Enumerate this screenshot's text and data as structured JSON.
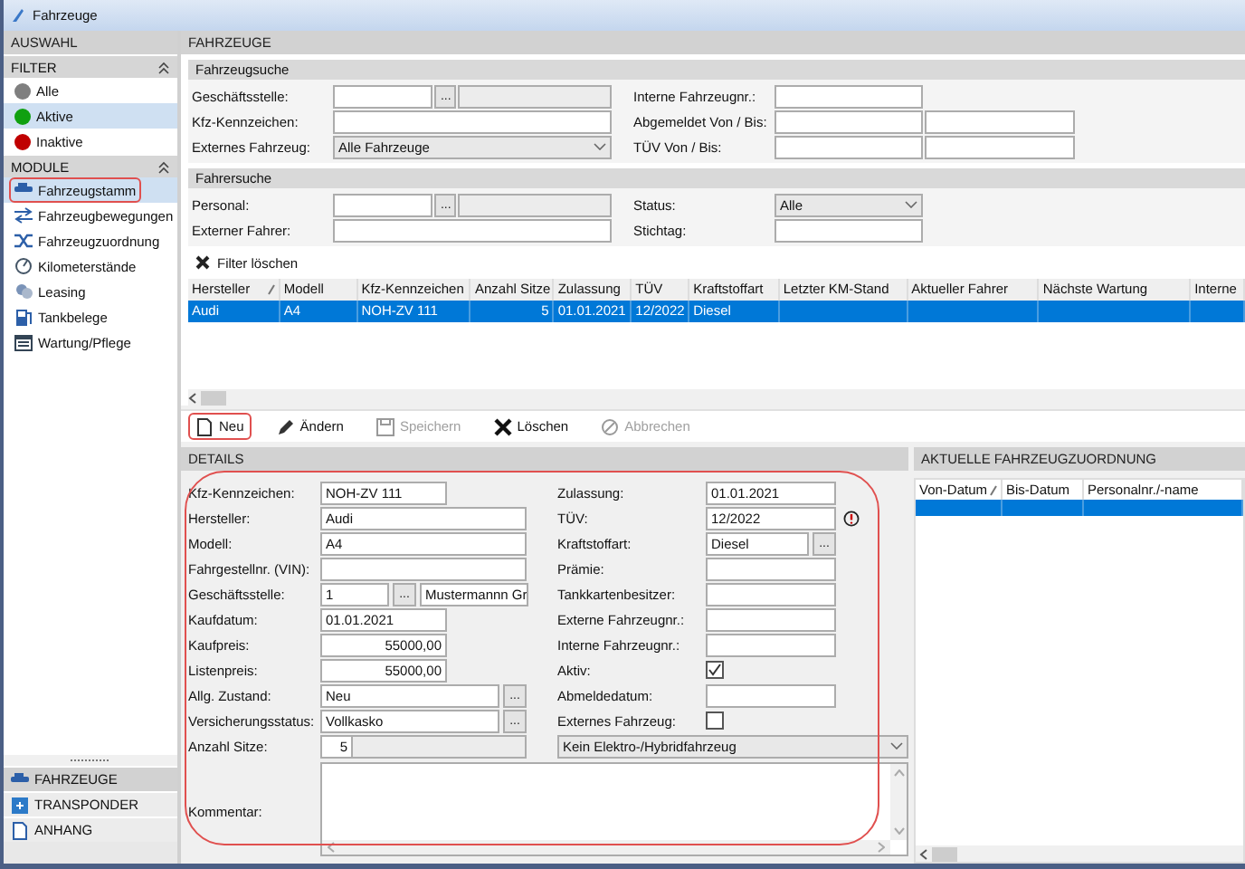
{
  "window": {
    "title": "Fahrzeuge"
  },
  "sidebar": {
    "title": "AUSWAHL",
    "sections": [
      {
        "title": "FILTER",
        "expanded": true,
        "items": [
          {
            "label": "Alle",
            "color": "#7f7f7f",
            "selected": false
          },
          {
            "label": "Aktive",
            "color": "#10a010",
            "selected": true
          },
          {
            "label": "Inaktive",
            "color": "#c00000",
            "selected": false
          }
        ]
      },
      {
        "title": "MODULE",
        "expanded": true,
        "items": [
          {
            "label": "Fahrzeugstamm",
            "selected": true,
            "highlighted": true
          },
          {
            "label": "Fahrzeugbewegungen",
            "selected": false,
            "highlighted": false
          },
          {
            "label": "Fahrzeugzuordnung",
            "selected": false,
            "highlighted": false
          },
          {
            "label": "Kilometerstände",
            "selected": false,
            "highlighted": false
          },
          {
            "label": "Leasing",
            "selected": false,
            "highlighted": false
          },
          {
            "label": "Tankbelege",
            "selected": false,
            "highlighted": false
          },
          {
            "label": "Wartung/Pflege",
            "selected": false,
            "highlighted": false
          }
        ]
      }
    ],
    "bottom_tabs": [
      {
        "label": "FAHRZEUGE",
        "selected": true
      },
      {
        "label": "TRANSPONDER",
        "selected": false
      },
      {
        "label": "ANHANG",
        "selected": false
      }
    ]
  },
  "main": {
    "title": "FAHRZEUGE"
  },
  "searches": [
    {
      "title": "Fahrzeugsuche",
      "left_fields": [
        {
          "label": "Geschäftsstelle:",
          "kind": "lookup",
          "button": "..."
        },
        {
          "label": "Kfz-Kennzeichen:",
          "kind": "text"
        },
        {
          "label": "Externes Fahrzeug:",
          "kind": "select",
          "value": "Alle Fahrzeuge"
        }
      ],
      "right_fields": [
        {
          "label": "Interne Fahrzeugnr.:",
          "kind": "text"
        },
        {
          "label": "Abgemeldet Von / Bis:",
          "kind": "range"
        },
        {
          "label": "TÜV Von / Bis:",
          "kind": "range"
        }
      ]
    },
    {
      "title": "Fahrersuche",
      "left_fields": [
        {
          "label": "Personal:",
          "kind": "lookup",
          "button": "..."
        },
        {
          "label": "Externer Fahrer:",
          "kind": "text"
        }
      ],
      "right_fields": [
        {
          "label": "Status:",
          "kind": "select",
          "value": "Alle"
        },
        {
          "label": "Stichtag:",
          "kind": "text"
        }
      ]
    }
  ],
  "filter_clear": "Filter löschen",
  "table": {
    "columns": [
      {
        "label": "Hersteller",
        "sorted": true
      },
      {
        "label": "Modell"
      },
      {
        "label": "Kfz-Kennzeichen"
      },
      {
        "label": "Anzahl Sitze"
      },
      {
        "label": "Zulassung"
      },
      {
        "label": "TÜV"
      },
      {
        "label": "Kraftstoffart"
      },
      {
        "label": "Letzter KM-Stand"
      },
      {
        "label": "Aktueller Fahrer"
      },
      {
        "label": "Nächste Wartung"
      },
      {
        "label": "Interne"
      }
    ],
    "rows": [
      {
        "selected": true,
        "cells": [
          "Audi",
          "A4",
          "NOH-ZV 111",
          "5",
          "01.01.2021",
          "12/2022",
          "Diesel"
        ]
      }
    ]
  },
  "toolbar": [
    {
      "label": "Neu",
      "disabled": false,
      "highlighted": true
    },
    {
      "label": "Ändern",
      "disabled": false,
      "highlighted": false
    },
    {
      "label": "Speichern",
      "disabled": true,
      "highlighted": false
    },
    {
      "label": "Löschen",
      "disabled": false,
      "highlighted": false
    },
    {
      "label": "Abbrechen",
      "disabled": true,
      "highlighted": false
    }
  ],
  "details": {
    "title": "DETAILS",
    "highlighted": true,
    "left_fields": [
      {
        "label": "Kfz-Kennzeichen:",
        "kind": "short",
        "value": "NOH-ZV 111"
      },
      {
        "label": "Hersteller:",
        "kind": "wide",
        "value": "Audi"
      },
      {
        "label": "Modell:",
        "kind": "wide",
        "value": "A4"
      },
      {
        "label": "Fahrgestellnr. (VIN):",
        "kind": "wide"
      },
      {
        "label": "Geschäftsstelle:",
        "kind": "lookup",
        "value": "1",
        "button": "...",
        "name": "Mustermannn Gr"
      },
      {
        "label": "Kaufdatum:",
        "kind": "short",
        "value": "01.01.2021"
      },
      {
        "label": "Kaufpreis:",
        "kind": "amount",
        "value": "55000,00"
      },
      {
        "label": "Listenpreis:",
        "kind": "amount",
        "value": "55000,00"
      },
      {
        "label": "Allg. Zustand:",
        "kind": "picker",
        "value": "Neu",
        "button": "..."
      },
      {
        "label": "Versicherungsstatus:",
        "kind": "picker",
        "value": "Vollkasko",
        "button": "..."
      },
      {
        "label": "Anzahl Sitze:",
        "kind": "number",
        "value": "5"
      },
      {
        "label": "Kommentar:",
        "kind": "memo"
      }
    ],
    "right_fields": [
      {
        "label": "Zulassung:",
        "kind": "text",
        "value": "01.01.2021"
      },
      {
        "label": "TÜV:",
        "kind": "warning",
        "value": "12/2022"
      },
      {
        "label": "Kraftstoffart:",
        "kind": "picker",
        "value": "Diesel",
        "button": "..."
      },
      {
        "label": "Prämie:",
        "kind": "text"
      },
      {
        "label": "Tankkartenbesitzer:",
        "kind": "text"
      },
      {
        "label": "Externe Fahrzeugnr.:",
        "kind": "text"
      },
      {
        "label": "Interne Fahrzeugnr.:",
        "kind": "text"
      },
      {
        "label": "Aktiv:",
        "kind": "checkbox",
        "checked": true
      },
      {
        "label": "Abmeldedatum:",
        "kind": "text"
      },
      {
        "label": "Externes Fahrzeug:",
        "kind": "checkbox",
        "checked": false
      },
      {
        "kind": "select",
        "value": "Kein Elektro-/Hybridfahrzeug"
      }
    ]
  },
  "assignment": {
    "title": "AKTUELLE FAHRZEUGZUORDNUNG",
    "columns": [
      {
        "label": "Von-Datum",
        "sorted": true
      },
      {
        "label": "Bis-Datum"
      },
      {
        "label": "Personalnr./-name"
      }
    ],
    "rows": [
      {
        "selected": true
      }
    ]
  }
}
